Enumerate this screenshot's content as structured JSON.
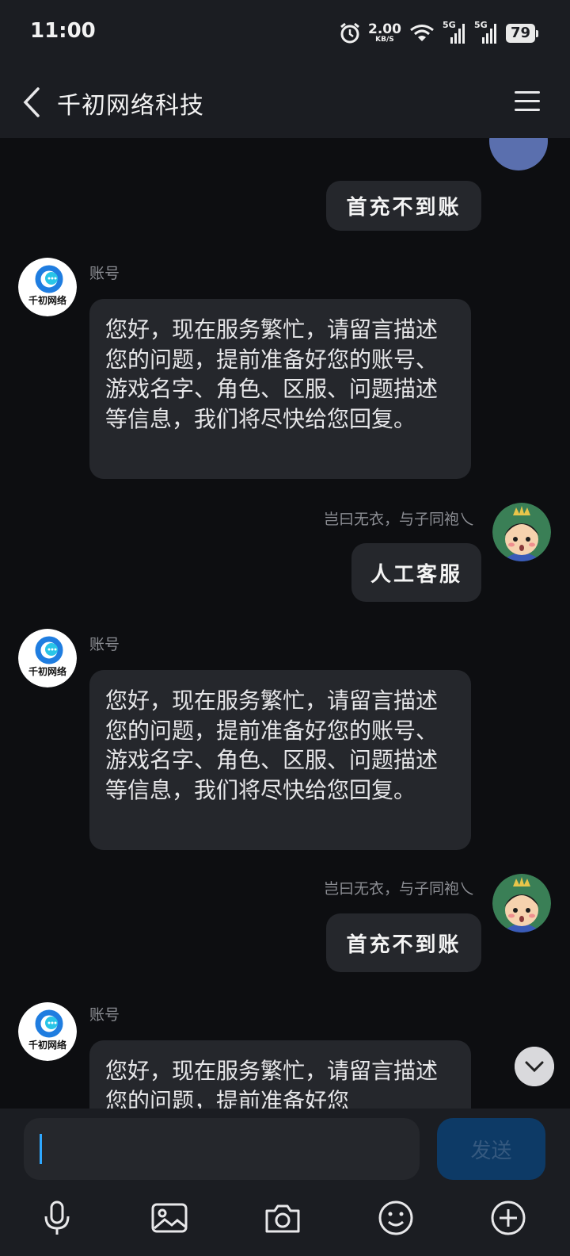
{
  "status_bar": {
    "time": "11:00",
    "network_speed": "2.00",
    "network_speed_unit": "KB/S",
    "signal_1_label": "5G",
    "signal_2_label": "5G",
    "battery_level": "79",
    "icons": [
      "alarm-icon",
      "wifi-icon",
      "signal-icon",
      "signal-icon",
      "battery-icon"
    ]
  },
  "header": {
    "title": "千初网络科技",
    "back_icon": "chevron-left-icon",
    "menu_icon": "hamburger-menu-icon"
  },
  "messages": [
    {
      "direction": "outgoing",
      "text": "首充不到账",
      "partial": true
    },
    {
      "direction": "incoming",
      "sender": "账号",
      "avatar_label": "千初网络",
      "text": "您好，现在服务繁忙，请留言描述您的问题，提前准备好您的账号、游戏名字、角色、区服、问题描述等信息，我们将尽快给您回复。"
    },
    {
      "direction": "outgoing",
      "sender": "岂曰无衣，与子同袍乀",
      "text": "人工客服"
    },
    {
      "direction": "incoming",
      "sender": "账号",
      "avatar_label": "千初网络",
      "text": "您好，现在服务繁忙，请留言描述您的问题，提前准备好您的账号、游戏名字、角色、区服、问题描述等信息，我们将尽快给您回复。"
    },
    {
      "direction": "outgoing",
      "sender": "岂曰无衣，与子同袍乀",
      "text": "首充不到账"
    },
    {
      "direction": "incoming",
      "sender": "账号",
      "avatar_label": "千初网络",
      "text": "您好，现在服务繁忙，请留言描述您的问题，提前准备好您",
      "partial": true
    }
  ],
  "composer": {
    "input_value": "",
    "send_label": "发送",
    "toolbar_icons": [
      "microphone-icon",
      "image-icon",
      "camera-icon",
      "emoji-icon",
      "plus-circle-icon"
    ]
  },
  "scroll_down_icon": "chevron-down-icon",
  "colors": {
    "background": "#0d0e11",
    "bar": "#1b1d22",
    "bubble": "#25272c",
    "send_button": "#0d3a66",
    "caret": "#2fa8ff"
  }
}
